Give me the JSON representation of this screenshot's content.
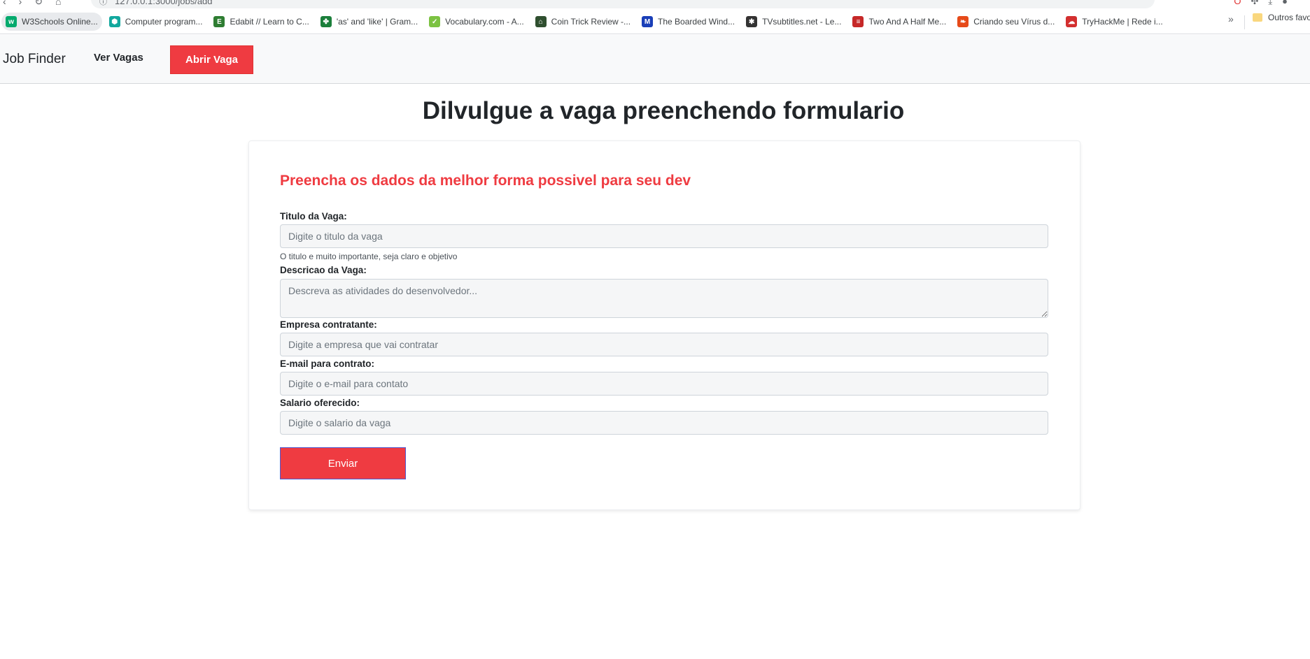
{
  "browser": {
    "url": "127.0.0.1:3000/jobs/add",
    "bookmarks": [
      {
        "label": "W3Schools Online...",
        "icon": "w3schools-icon",
        "color": "#04aa6d",
        "glyph": "w",
        "active": true
      },
      {
        "label": "Computer program...",
        "icon": "hexagon-icon",
        "color": "#13a89e",
        "glyph": "⬢"
      },
      {
        "label": "Edabit // Learn to C...",
        "icon": "edabit-icon",
        "color": "#2e7d32",
        "glyph": "E"
      },
      {
        "label": "'as' and 'like' | Gram...",
        "icon": "clover-icon",
        "color": "#1b7f3b",
        "glyph": "✤"
      },
      {
        "label": "Vocabulary.com - A...",
        "icon": "checkmark-icon",
        "color": "#7cc242",
        "glyph": "✓"
      },
      {
        "label": "Coin Trick Review -...",
        "icon": "coin-icon",
        "color": "#2f4f2f",
        "glyph": "⌂"
      },
      {
        "label": "The Boarded Wind...",
        "icon": "mt-logo-icon",
        "color": "#1a3fb8",
        "glyph": "M"
      },
      {
        "label": "TVsubtitles.net - Le...",
        "icon": "film-reel-icon",
        "color": "#333333",
        "glyph": "✱"
      },
      {
        "label": "Two And A Half Me...",
        "icon": "tv-logo-icon",
        "color": "#c62828",
        "glyph": "≡"
      },
      {
        "label": "Criando seu Vírus d...",
        "icon": "shrimp-icon",
        "color": "#e64a19",
        "glyph": "❧"
      },
      {
        "label": "TryHackMe | Rede i...",
        "icon": "cloud-icon",
        "color": "#d32f2f",
        "glyph": "☁"
      }
    ],
    "other_bookmarks": "Outros favo"
  },
  "navbar": {
    "brand": "Job Finder",
    "link": "Ver Vagas",
    "button": "Abrir Vaga"
  },
  "page": {
    "title": "Dilvulgue a vaga preenchendo formulario"
  },
  "form": {
    "heading": "Preencha os dados da melhor forma possivel para seu dev",
    "title_label": "Titulo da Vaga:",
    "title_placeholder": "Digite o titulo da vaga",
    "title_help": "O titulo e muito importante, seja claro e objetivo",
    "description_label": "Descricao da Vaga:",
    "description_placeholder": "Descreva as atividades do desenvolvedor...",
    "company_label": "Empresa contratante:",
    "company_placeholder": "Digite a empresa que vai contratar",
    "email_label": "E-mail para contrato:",
    "email_placeholder": "Digite o e-mail para contato",
    "salary_label": "Salario oferecido:",
    "salary_placeholder": "Digite o salario da vaga",
    "submit": "Enviar"
  },
  "colors": {
    "accent": "#ef3b41",
    "navbar_bg": "#f8f9fa",
    "input_bg": "#f5f6f7"
  }
}
